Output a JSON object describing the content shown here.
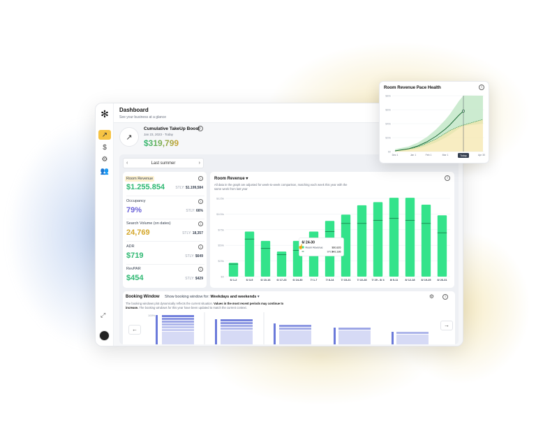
{
  "app": {
    "title": "Dashboard",
    "subtitle": "See your business at a glance",
    "logo_icon": "asterisk-logo",
    "nav": [
      {
        "icon": "trending-up-icon",
        "active": true
      },
      {
        "icon": "dollar-icon",
        "active": false
      },
      {
        "icon": "gear-icon",
        "active": false
      },
      {
        "icon": "users-icon",
        "active": false
      }
    ]
  },
  "boost": {
    "title": "Cumulative TakeUp Boost",
    "date": "Jan 23, 2023 - Today",
    "value": "$319,799"
  },
  "period": {
    "label": "Last summer"
  },
  "metrics": [
    {
      "label": "Room Revenue",
      "value": "$1.255.854",
      "stly_label": "STLY:",
      "stly": "$1.199,584",
      "color": "#2eb872",
      "highlight": true
    },
    {
      "label": "Occupancy",
      "value": "79%",
      "stly_label": "STLY:",
      "stly": "66%",
      "color": "#6b63d9",
      "highlight": false
    },
    {
      "label": "Search Volume (on dates)",
      "value": "24,769",
      "stly_label": "STLY:",
      "stly": "18,357",
      "color": "#d4a72c",
      "highlight": false
    },
    {
      "label": "ADR",
      "value": "$719",
      "stly_label": "STLY:",
      "stly": "$649",
      "color": "#2eb872",
      "highlight": false
    },
    {
      "label": "RevPAR",
      "value": "$454",
      "stly_label": "STLY:",
      "stly": "$429",
      "color": "#2eb872",
      "highlight": false
    }
  ],
  "revenue_chart": {
    "title": "Room Revenue",
    "note": "All data in the graph are adjusted for week-to-week comparison, matching each week this year with the same week from last year",
    "tooltip": {
      "title": "6/ 24-30",
      "row1_label": "Room Revenue",
      "row1_value": "$60,826",
      "row2_label": "STLY",
      "row2_value": "$42,186"
    }
  },
  "chart_data": [
    {
      "type": "bar",
      "title": "Room Revenue",
      "categories": [
        "6/ 1-2",
        "6/ 3-9",
        "6/ 10-16",
        "6/ 17-23",
        "6/ 24-30",
        "7/ 1-7",
        "7/ 8-14",
        "7/ 15-21",
        "7/ 22-28",
        "7/ 29 - 8/ 4",
        "8/ 5-11",
        "8/ 12-18",
        "8/ 19-25",
        "8/ 26-31"
      ],
      "series": [
        {
          "name": "Room Revenue",
          "values": [
            22,
            72,
            57,
            40,
            57,
            72,
            89,
            99,
            114,
            119,
            126,
            126,
            115,
            98
          ]
        },
        {
          "name": "STLY",
          "values": [
            20,
            60,
            45,
            35,
            42,
            62,
            72,
            85,
            85,
            90,
            93,
            90,
            85,
            70
          ]
        }
      ],
      "yticks": [
        "$0",
        "$25k",
        "$50k",
        "$75k",
        "$100k",
        "$125k"
      ],
      "ylim": [
        0,
        125
      ],
      "ylabel": ""
    },
    {
      "type": "line",
      "title": "Room Revenue Pace Health",
      "xticks": [
        "Dec 1",
        "Jan 1",
        "Feb 1",
        "Mar 1",
        "Apr 30"
      ],
      "yticks": [
        "$0",
        "$20k",
        "$40k",
        "$60k",
        "$80k"
      ],
      "today_label": "Today",
      "series": [
        {
          "name": "",
          "values": [
            1,
            2,
            3,
            4,
            6,
            8,
            11,
            14,
            18,
            22,
            27,
            32,
            38,
            45,
            52,
            58
          ]
        },
        {
          "name": "",
          "values": [
            1,
            2,
            3,
            4,
            5,
            7,
            9,
            12,
            15,
            18,
            22,
            26,
            30,
            33,
            36,
            38
          ]
        }
      ],
      "ylim": [
        0,
        80
      ]
    }
  ],
  "booking_window": {
    "title": "Booking Window",
    "show_label": "Show booking window for:",
    "show_value": "Weekdays and weekends",
    "note_plain": "The booking windows plot dynamically reflects the current situation.",
    "note_bold": "Values in the most recent periods may continue to increase.",
    "note_tail": "The booking windows for this year have been updated to match the current context.",
    "tick": "100%"
  }
}
